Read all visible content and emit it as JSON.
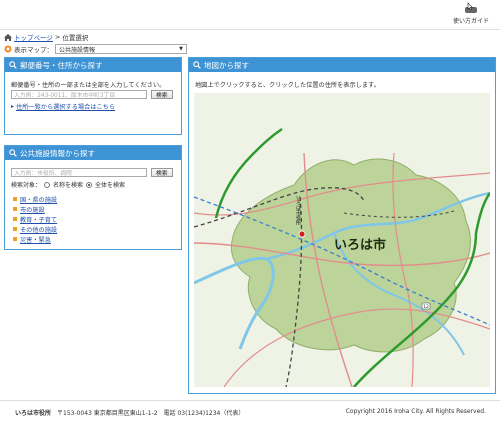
{
  "header": {
    "guide_label": "使い方ガイド"
  },
  "breadcrumb": {
    "home_link": "トップページ",
    "separator": ">",
    "current": "位置選択"
  },
  "map_select": {
    "caption": "表示マップ：",
    "selected": "公共施設情報"
  },
  "address_panel": {
    "title": "郵便番号・住所から探す",
    "description": "郵便番号・住所の一部または全部を入力してください。",
    "input_placeholder": "入力例：243-0011、厚木市中町3丁目",
    "search_label": "検索",
    "list_link": "住所一覧から選択する場合はこちら"
  },
  "facility_panel": {
    "title": "公共施設情報から探す",
    "input_placeholder": "入力例：市役所、病院",
    "search_label": "検索",
    "target_caption": "検索対象：",
    "option_name": "名称を検索",
    "option_all": "全体を検索",
    "categories": [
      "国・県の施設",
      "市の施設",
      "教育・子育て",
      "その他の施設",
      "災害・緊急"
    ]
  },
  "map_panel": {
    "title": "地図から探す",
    "description": "地図上でクリックすると、クリックした位置の住所を表示します。",
    "city_label": "いろは市",
    "office_label": "いろは市役所",
    "route_label": "12"
  },
  "footer": {
    "org": "いろは市役所",
    "address": "〒153-0043 東京都目黒区東山1-1-2　電話 03(1234)1234（代表）",
    "copyright": "Copyright 2016 Iroha City. All Rights Reserved."
  },
  "colors": {
    "panel_header": "#3d93d4",
    "city_area": "#bcd49a",
    "river": "#7fc6e8",
    "expressway": "#2e9a2e",
    "road": "#e38c8c",
    "link": "#1f4fa8"
  }
}
